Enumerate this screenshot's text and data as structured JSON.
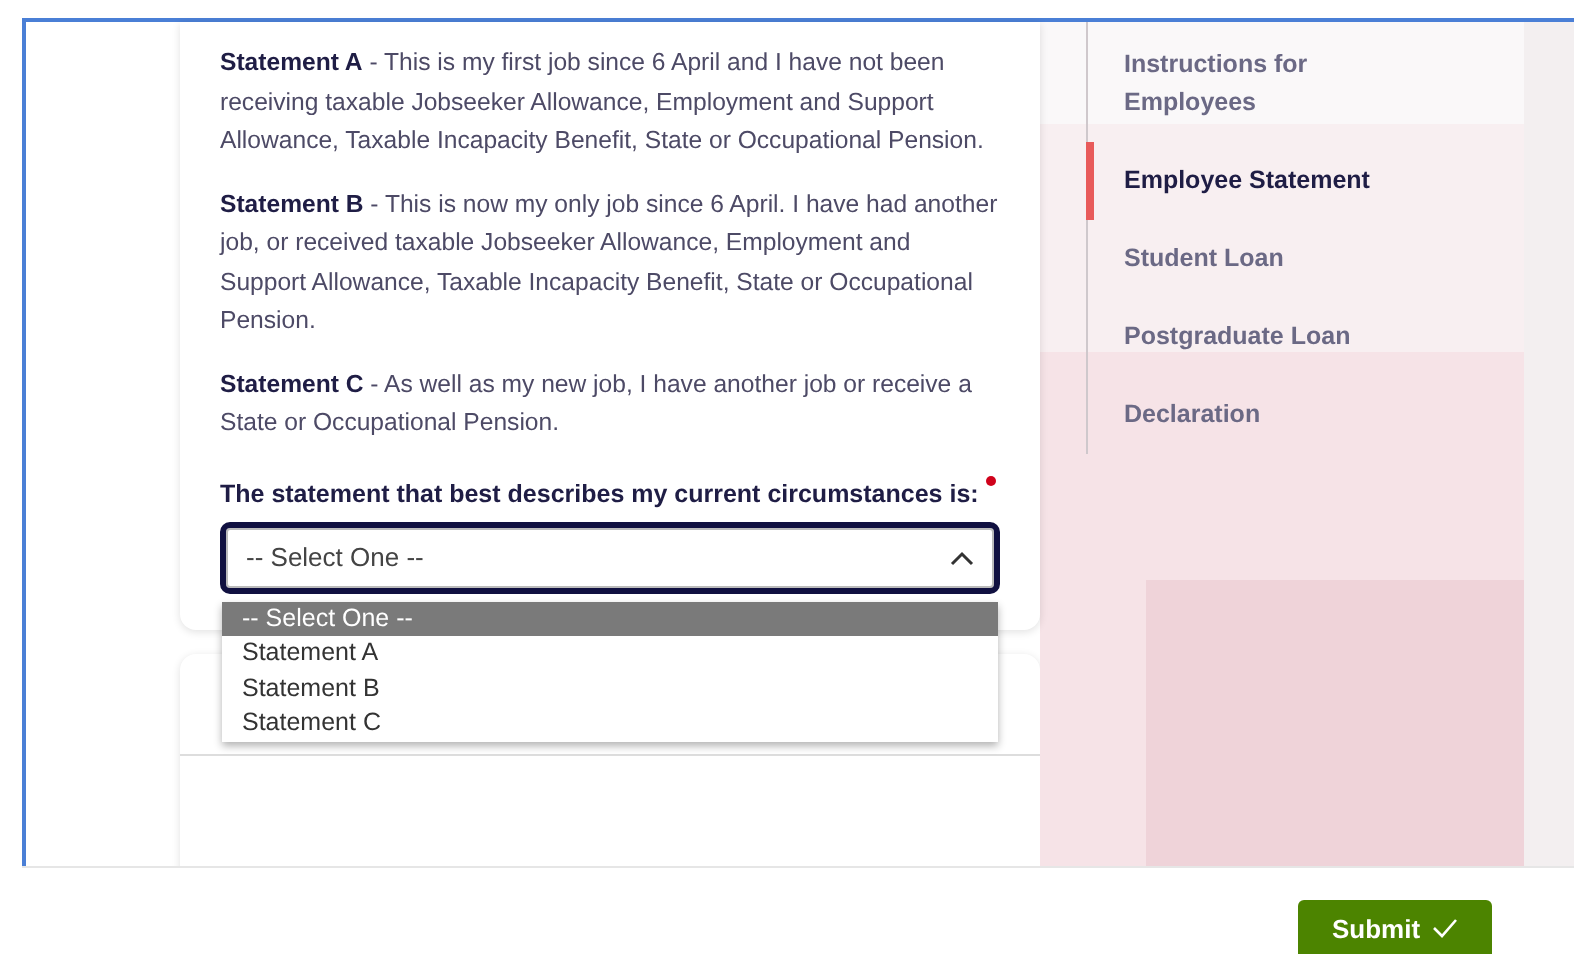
{
  "statements": [
    {
      "text": "**Statement A** - This is my first job since 6 April and I have not been receiving taxable Jobseeker Allowance, Employment and Support Allowance, Taxable Incapacity Benefit, State or Occupational Pension."
    },
    {
      "text": "**Statement B** - This is now my only job since 6 April. I have had another job, or received taxable Jobseeker Allowance, Employment and Support Allowance, Taxable Incapacity Benefit, State or Occupational Pension."
    },
    {
      "text": "**Statement C** - As well as my new job, I have another job or receive a State or Occupational Pension."
    }
  ],
  "question": {
    "label": "The statement that best describes my current circumstances is:",
    "required": true
  },
  "select": {
    "value": "-- Select One --",
    "expanded": true,
    "options": [
      {
        "label": "-- Select One --",
        "selected": true
      },
      {
        "label": "Statement A",
        "selected": false
      },
      {
        "label": "Statement B",
        "selected": false
      },
      {
        "label": "Statement C",
        "selected": false
      }
    ]
  },
  "nav": {
    "items": [
      {
        "label": "Instructions for Employees",
        "selected": false
      },
      {
        "label": "Employee Statement",
        "selected": true
      },
      {
        "label": "Student Loan",
        "selected": false
      },
      {
        "label": "Postgraduate Loan",
        "selected": false
      },
      {
        "label": "Declaration",
        "selected": false
      }
    ]
  },
  "submit": {
    "label": "Submit"
  }
}
